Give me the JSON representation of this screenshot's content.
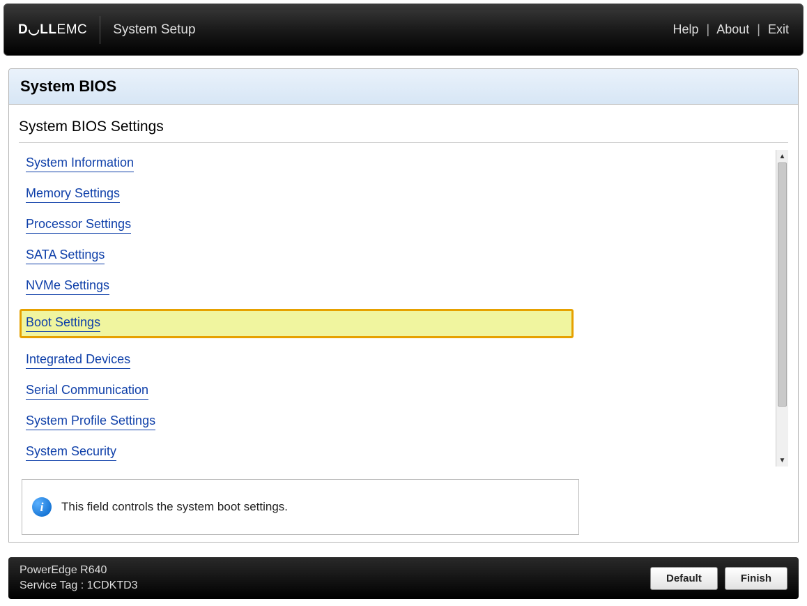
{
  "header": {
    "logo_bold": "D◡LL",
    "logo_thin": "EMC",
    "app_title": "System Setup",
    "links": {
      "help": "Help",
      "about": "About",
      "exit": "Exit"
    }
  },
  "panel": {
    "title": "System BIOS",
    "subtitle": "System BIOS Settings"
  },
  "menu": [
    {
      "label": "System Information",
      "highlighted": false
    },
    {
      "label": "Memory Settings",
      "highlighted": false
    },
    {
      "label": "Processor Settings",
      "highlighted": false
    },
    {
      "label": "SATA Settings",
      "highlighted": false
    },
    {
      "label": "NVMe Settings",
      "highlighted": false
    },
    {
      "label": "Boot Settings",
      "highlighted": true
    },
    {
      "label": "Integrated Devices",
      "highlighted": false
    },
    {
      "label": "Serial Communication",
      "highlighted": false
    },
    {
      "label": "System Profile Settings",
      "highlighted": false
    },
    {
      "label": "System Security",
      "highlighted": false
    }
  ],
  "info": {
    "text": "This field controls the system boot settings."
  },
  "footer": {
    "model": "PowerEdge R640",
    "service_tag_label": "Service Tag :",
    "service_tag": "1CDKTD3",
    "buttons": {
      "default": "Default",
      "finish": "Finish"
    }
  }
}
